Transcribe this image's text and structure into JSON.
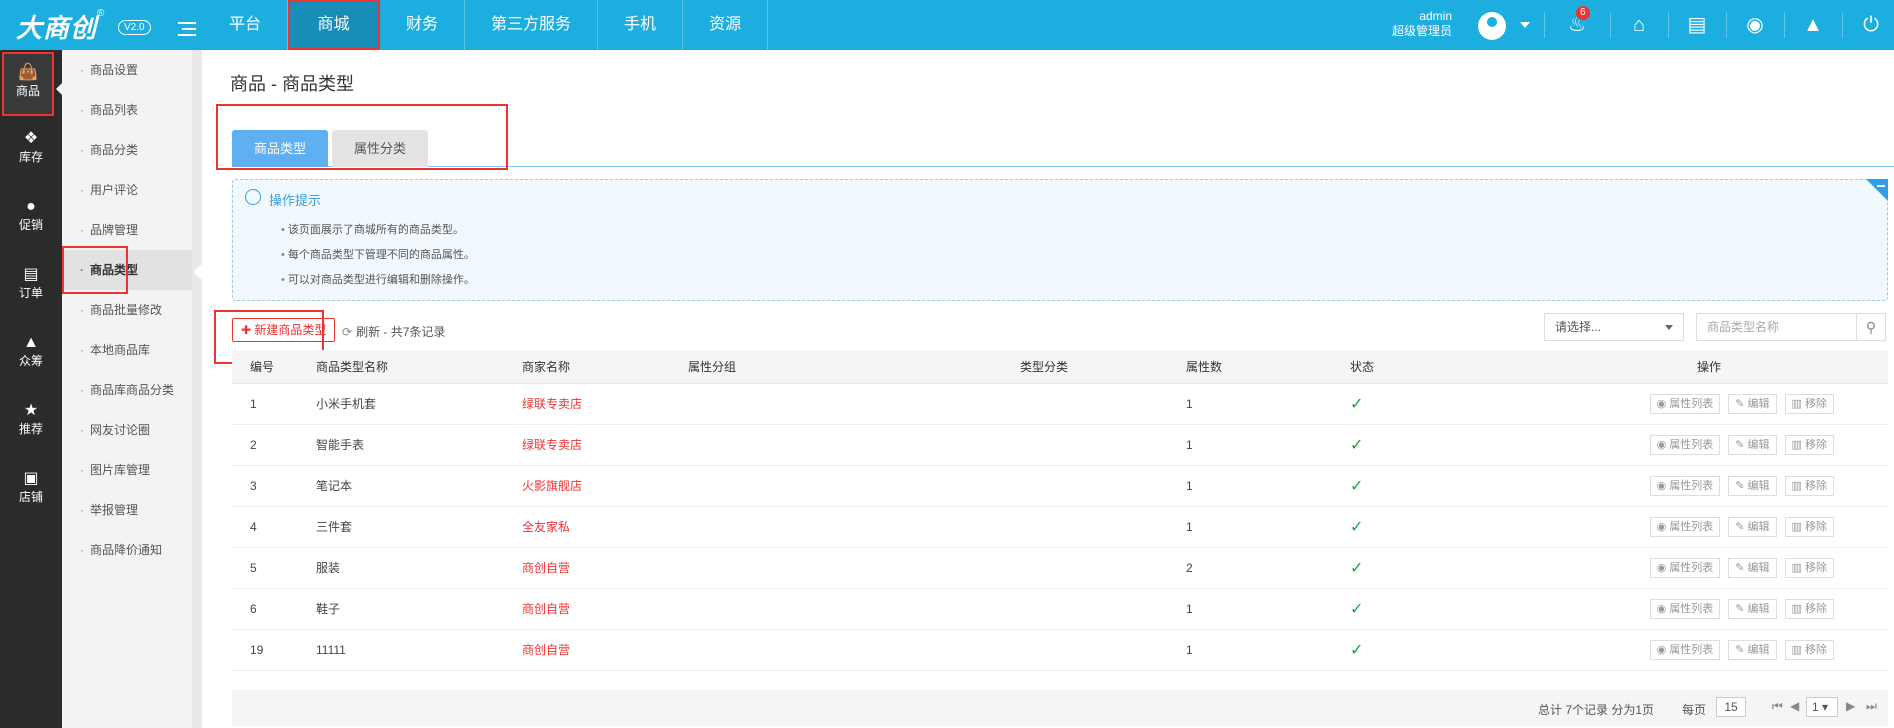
{
  "app": {
    "logo_text": "大商创",
    "logo_mark": "®",
    "version": "V2.0"
  },
  "top_nav": [
    {
      "label": "平台"
    },
    {
      "label": "商城"
    },
    {
      "label": "财务"
    },
    {
      "label": "第三方服务"
    },
    {
      "label": "手机"
    },
    {
      "label": "资源"
    }
  ],
  "user": {
    "name": "admin",
    "role": "超级管理员",
    "notifications": "6"
  },
  "top_icons": [
    "bell-icon",
    "home-icon",
    "sitemap-icon",
    "palette-icon",
    "broom-icon",
    "power-icon"
  ],
  "left_nav": [
    {
      "label": "商品",
      "icon": "bag-icon"
    },
    {
      "label": "库存",
      "icon": "boxes-icon"
    },
    {
      "label": "促销",
      "icon": "tag-icon"
    },
    {
      "label": "订单",
      "icon": "clipboard-icon"
    },
    {
      "label": "众筹",
      "icon": "crowd-icon"
    },
    {
      "label": "推荐",
      "icon": "star-icon"
    },
    {
      "label": "店铺",
      "icon": "store-icon"
    }
  ],
  "sidebar": [
    {
      "label": "商品设置"
    },
    {
      "label": "商品列表"
    },
    {
      "label": "商品分类"
    },
    {
      "label": "用户评论"
    },
    {
      "label": "品牌管理"
    },
    {
      "label": "商品类型"
    },
    {
      "label": "商品批量修改"
    },
    {
      "label": "本地商品库"
    },
    {
      "label": "商品库商品分类"
    },
    {
      "label": "网友讨论圈"
    },
    {
      "label": "图片库管理"
    },
    {
      "label": "举报管理"
    },
    {
      "label": "商品降价通知"
    }
  ],
  "page": {
    "title": "商品 - 商品类型"
  },
  "tabs": [
    {
      "label": "商品类型"
    },
    {
      "label": "属性分类"
    }
  ],
  "tips": {
    "title": "操作提示",
    "items": [
      "该页面展示了商城所有的商品类型。",
      "每个商品类型下管理不同的商品属性。",
      "可以对商品类型进行编辑和删除操作。"
    ]
  },
  "toolbar": {
    "new_label": "新建商品类型",
    "refresh_label": "刷新 - 共7条记录",
    "select_value": "请选择...",
    "search_placeholder": "商品类型名称"
  },
  "table": {
    "headers": [
      "编号",
      "商品类型名称",
      "商家名称",
      "属性分组",
      "类型分类",
      "属性数",
      "状态",
      "操作"
    ],
    "actions": {
      "attr_list": "属性列表",
      "edit": "编辑",
      "remove": "移除"
    },
    "rows": [
      {
        "id": "1",
        "name": "小米手机套",
        "shop": "绿联专卖店",
        "count": "1"
      },
      {
        "id": "2",
        "name": "智能手表",
        "shop": "绿联专卖店",
        "count": "1"
      },
      {
        "id": "3",
        "name": "笔记本",
        "shop": "火影旗舰店",
        "count": "1"
      },
      {
        "id": "4",
        "name": "三件套",
        "shop": "全友家私",
        "count": "1"
      },
      {
        "id": "5",
        "name": "服装",
        "shop": "商创自营",
        "count": "2"
      },
      {
        "id": "6",
        "name": "鞋子",
        "shop": "商创自营",
        "count": "1"
      },
      {
        "id": "19",
        "name": "11111",
        "shop": "商创自营",
        "count": "1"
      }
    ]
  },
  "pagination": {
    "summary": "总计 7个记录 分为1页",
    "per_page_label": "每页",
    "per_page": "15",
    "current_page": "1"
  },
  "colors": {
    "topbar": "#1daee0",
    "accent_red": "#e33333",
    "tab_active": "#5eb0f2",
    "check_green": "#1aa34a"
  }
}
